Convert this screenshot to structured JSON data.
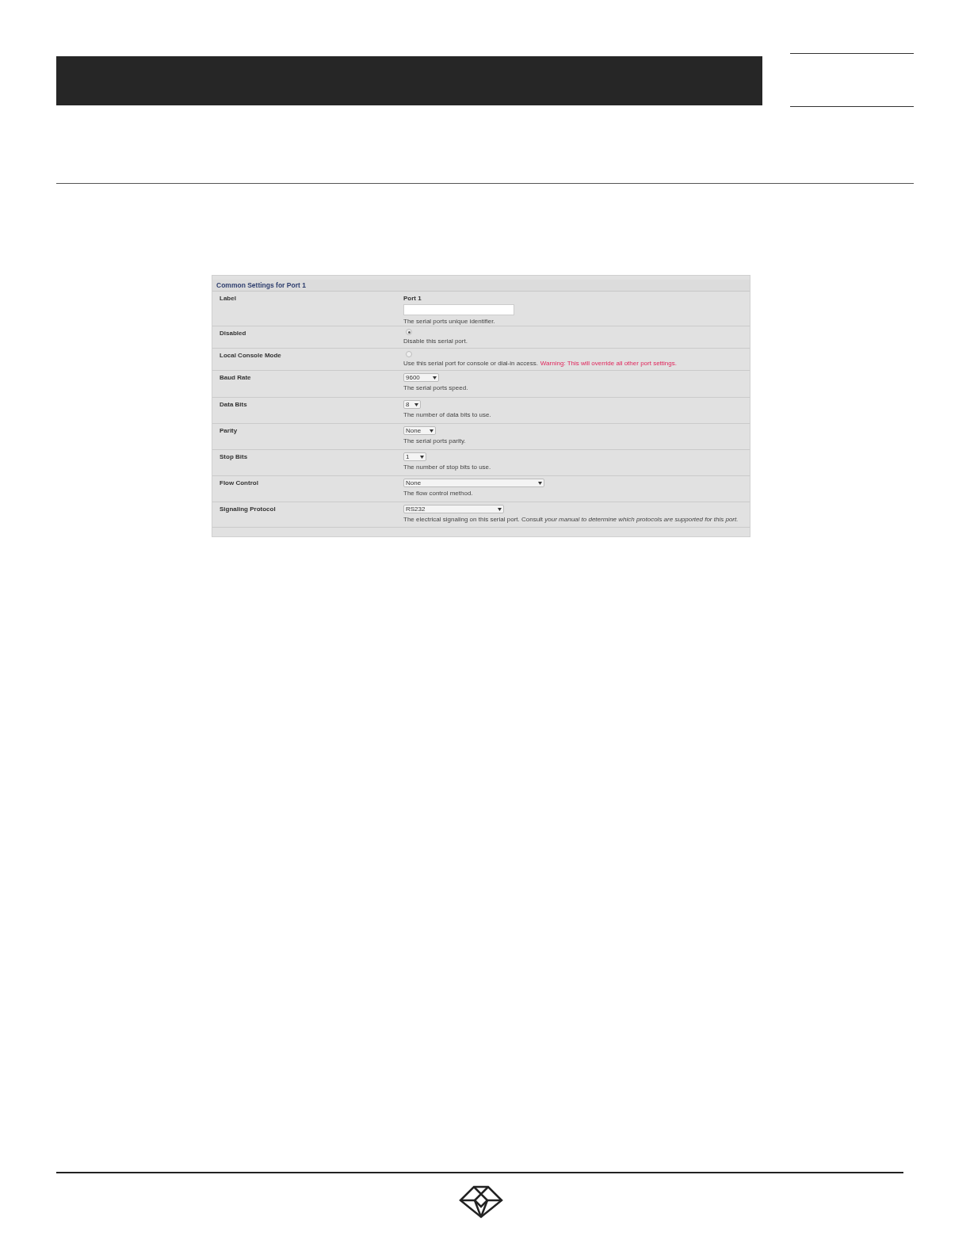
{
  "panel": {
    "title": "Common Settings for Port 1",
    "rows": [
      {
        "kind": "text",
        "label": "Label",
        "caption": "Port 1",
        "value": "",
        "description": "The serial ports unique identifier."
      },
      {
        "kind": "checkbox",
        "label": "Disabled",
        "checked": true,
        "description": "Disable this serial port."
      },
      {
        "kind": "checkbox",
        "label": "Local Console Mode",
        "checked": false,
        "description": "Use this serial port for console or dial-in access.",
        "warning": "Warning: This will override all other port settings."
      },
      {
        "kind": "select",
        "label": "Baud Rate",
        "value": "9600",
        "description": "The serial ports speed."
      },
      {
        "kind": "select",
        "label": "Data Bits",
        "value": "8",
        "description": "The number of data bits to use."
      },
      {
        "kind": "select",
        "label": "Parity",
        "value": "None",
        "description": "The serial ports parity."
      },
      {
        "kind": "select",
        "label": "Stop Bits",
        "value": "1",
        "description": "The number of stop bits to use."
      },
      {
        "kind": "select",
        "label": "Flow Control",
        "value": "None",
        "description": "The flow control method."
      },
      {
        "kind": "select",
        "label": "Signaling Protocol",
        "value": "RS232",
        "description": "The electrical signaling on this serial port. Consult *your manual to determine which protocols are supported for this port.*"
      }
    ]
  }
}
